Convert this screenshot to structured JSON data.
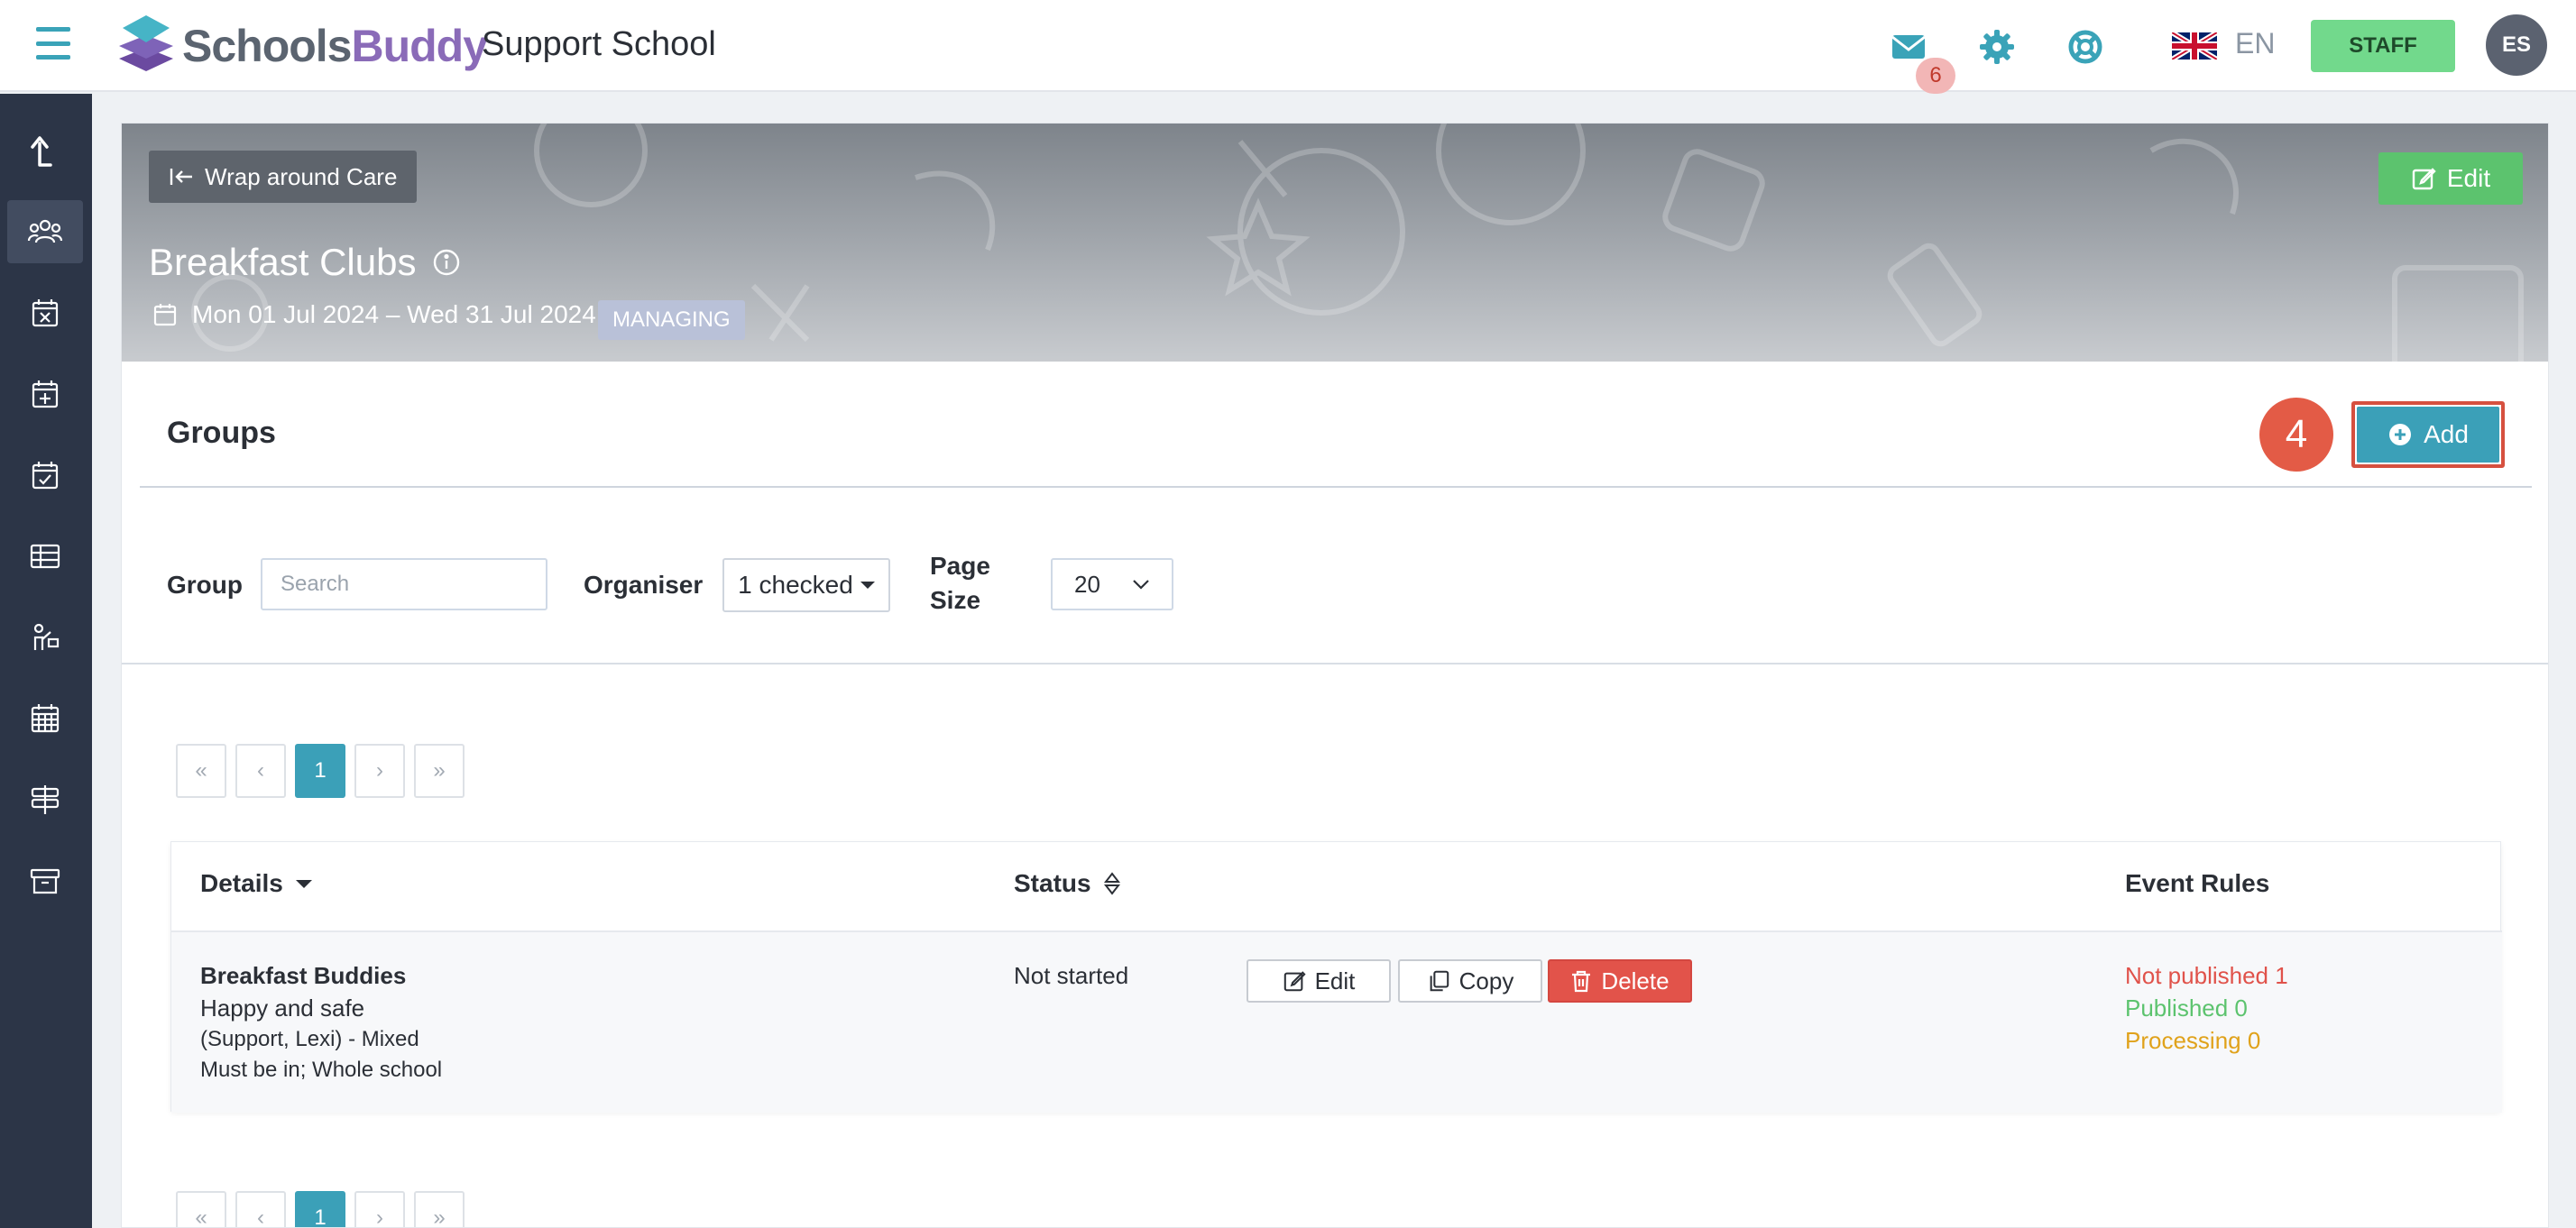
{
  "app": {
    "logo_text_a": "Schools",
    "logo_text_b": "Buddy",
    "school_name": "Support School"
  },
  "topbar": {
    "mail_count": "6",
    "language": "EN",
    "staff_label": "STAFF",
    "avatar_initials": "ES"
  },
  "hero": {
    "back_label": "Wrap around Care",
    "edit_label": "Edit",
    "title": "Breakfast Clubs",
    "dates": "Mon 01 Jul 2024 – Wed 31 Jul 2024",
    "badge": "MANAGING"
  },
  "groups": {
    "title": "Groups",
    "step_number": "4",
    "add_label": "Add"
  },
  "filters": {
    "group_label": "Group",
    "search_placeholder": "Search",
    "organiser_label": "Organiser",
    "organiser_value": "1 checked",
    "page_size_label_1": "Page",
    "page_size_label_2": "Size",
    "page_size_value": "20"
  },
  "pagination": {
    "first": "«",
    "prev": "‹",
    "current": "1",
    "next": "›",
    "last": "»"
  },
  "table": {
    "columns": {
      "details": "Details",
      "status": "Status",
      "event_rules": "Event Rules"
    },
    "rows": [
      {
        "name": "Breakfast Buddies",
        "description": "Happy and safe",
        "organiser": "(Support, Lexi) - Mixed",
        "requirement": "Must be in; Whole school",
        "status": "Not started",
        "edit_label": "Edit",
        "copy_label": "Copy",
        "delete_label": "Delete",
        "rule_not_published": "Not published 1",
        "rule_published": "Published 0",
        "rule_processing": "Processing 0"
      }
    ]
  },
  "colors": {
    "accent": "#3ba0b8",
    "sidebar": "#2c3547",
    "success": "#5cc36e",
    "danger": "#e2534a",
    "warning": "#e0a21b",
    "staff": "#72d98c"
  }
}
